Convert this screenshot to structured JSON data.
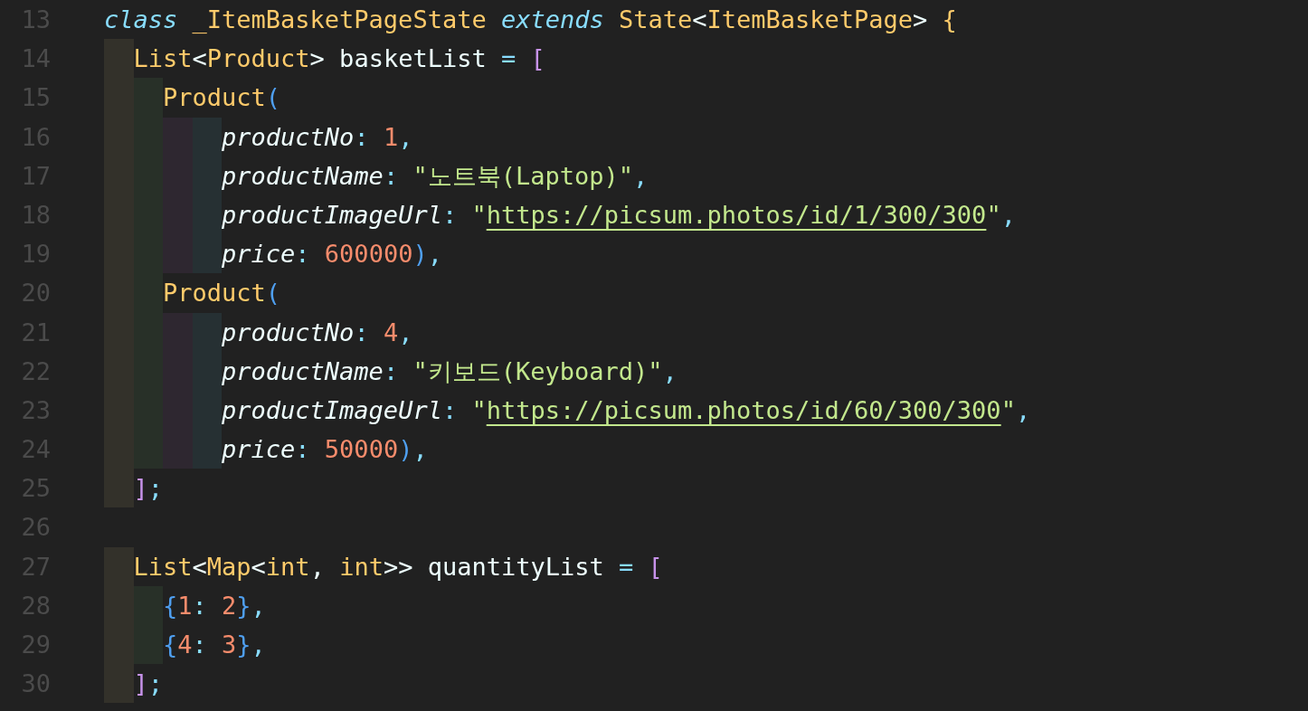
{
  "editor": {
    "lines": [
      {
        "number": "13",
        "tokens": [
          {
            "text": "class ",
            "kind": "keyword"
          },
          {
            "text": "_ItemBasketPageState ",
            "kind": "type"
          },
          {
            "text": "extends ",
            "kind": "keyword"
          },
          {
            "text": "State",
            "kind": "type"
          },
          {
            "text": "<",
            "kind": "plain"
          },
          {
            "text": "ItemBasketPage",
            "kind": "type"
          },
          {
            "text": "> ",
            "kind": "plain"
          },
          {
            "text": "{",
            "kind": "type"
          }
        ]
      },
      {
        "number": "14",
        "tokens": [
          {
            "text": "  List",
            "kind": "type"
          },
          {
            "text": "<",
            "kind": "plain"
          },
          {
            "text": "Product",
            "kind": "type"
          },
          {
            "text": "> basketList ",
            "kind": "plain"
          },
          {
            "text": "= ",
            "kind": "operator"
          },
          {
            "text": "[",
            "kind": "bracket-pink"
          }
        ]
      },
      {
        "number": "15",
        "tokens": [
          {
            "text": "    Product",
            "kind": "type"
          },
          {
            "text": "(",
            "kind": "bracket-blue"
          }
        ]
      },
      {
        "number": "16",
        "tokens": [
          {
            "text": "        productNo",
            "kind": "property"
          },
          {
            "text": ": ",
            "kind": "operator"
          },
          {
            "text": "1",
            "kind": "number"
          },
          {
            "text": ",",
            "kind": "operator"
          }
        ]
      },
      {
        "number": "17",
        "tokens": [
          {
            "text": "        productName",
            "kind": "property"
          },
          {
            "text": ": ",
            "kind": "operator"
          },
          {
            "text": "\"노트북(Laptop)\"",
            "kind": "string"
          },
          {
            "text": ",",
            "kind": "operator"
          }
        ]
      },
      {
        "number": "18",
        "tokens": [
          {
            "text": "        productImageUrl",
            "kind": "property"
          },
          {
            "text": ": ",
            "kind": "operator"
          },
          {
            "text": "\"",
            "kind": "string"
          },
          {
            "text": "https://picsum.photos/id/1/300/300",
            "kind": "link"
          },
          {
            "text": "\"",
            "kind": "string"
          },
          {
            "text": ",",
            "kind": "operator"
          }
        ]
      },
      {
        "number": "19",
        "tokens": [
          {
            "text": "        price",
            "kind": "property"
          },
          {
            "text": ": ",
            "kind": "operator"
          },
          {
            "text": "600000",
            "kind": "number"
          },
          {
            "text": ")",
            "kind": "bracket-blue"
          },
          {
            "text": ",",
            "kind": "operator"
          }
        ]
      },
      {
        "number": "20",
        "tokens": [
          {
            "text": "    Product",
            "kind": "type"
          },
          {
            "text": "(",
            "kind": "bracket-blue"
          }
        ]
      },
      {
        "number": "21",
        "tokens": [
          {
            "text": "        productNo",
            "kind": "property"
          },
          {
            "text": ": ",
            "kind": "operator"
          },
          {
            "text": "4",
            "kind": "number"
          },
          {
            "text": ",",
            "kind": "operator"
          }
        ]
      },
      {
        "number": "22",
        "tokens": [
          {
            "text": "        productName",
            "kind": "property"
          },
          {
            "text": ": ",
            "kind": "operator"
          },
          {
            "text": "\"키보드(Keyboard)\"",
            "kind": "string"
          },
          {
            "text": ",",
            "kind": "operator"
          }
        ]
      },
      {
        "number": "23",
        "tokens": [
          {
            "text": "        productImageUrl",
            "kind": "property"
          },
          {
            "text": ": ",
            "kind": "operator"
          },
          {
            "text": "\"",
            "kind": "string"
          },
          {
            "text": "https://picsum.photos/id/60/300/300",
            "kind": "link"
          },
          {
            "text": "\"",
            "kind": "string"
          },
          {
            "text": ",",
            "kind": "operator"
          }
        ]
      },
      {
        "number": "24",
        "tokens": [
          {
            "text": "        price",
            "kind": "property"
          },
          {
            "text": ": ",
            "kind": "operator"
          },
          {
            "text": "50000",
            "kind": "number"
          },
          {
            "text": ")",
            "kind": "bracket-blue"
          },
          {
            "text": ",",
            "kind": "operator"
          }
        ]
      },
      {
        "number": "25",
        "tokens": [
          {
            "text": "  ]",
            "kind": "bracket-pink"
          },
          {
            "text": ";",
            "kind": "operator"
          }
        ]
      },
      {
        "number": "26"
      },
      {
        "number": "27",
        "tokens": [
          {
            "text": "  List",
            "kind": "type"
          },
          {
            "text": "<",
            "kind": "plain"
          },
          {
            "text": "Map",
            "kind": "type"
          },
          {
            "text": "<",
            "kind": "plain"
          },
          {
            "text": "int",
            "kind": "type"
          },
          {
            "text": ", ",
            "kind": "plain"
          },
          {
            "text": "int",
            "kind": "type"
          },
          {
            "text": ">> quantityList ",
            "kind": "plain"
          },
          {
            "text": "= ",
            "kind": "operator"
          },
          {
            "text": "[",
            "kind": "bracket-pink"
          }
        ]
      },
      {
        "number": "28",
        "tokens": [
          {
            "text": "    {",
            "kind": "bracket-blue"
          },
          {
            "text": "1",
            "kind": "number"
          },
          {
            "text": ": ",
            "kind": "operator"
          },
          {
            "text": "2",
            "kind": "number"
          },
          {
            "text": "}",
            "kind": "bracket-blue"
          },
          {
            "text": ",",
            "kind": "operator"
          }
        ]
      },
      {
        "number": "29",
        "tokens": [
          {
            "text": "    {",
            "kind": "bracket-blue"
          },
          {
            "text": "4",
            "kind": "number"
          },
          {
            "text": ": ",
            "kind": "operator"
          },
          {
            "text": "3",
            "kind": "number"
          },
          {
            "text": "}",
            "kind": "bracket-blue"
          },
          {
            "text": ",",
            "kind": "operator"
          }
        ]
      },
      {
        "number": "30",
        "tokens": [
          {
            "text": "  ]",
            "kind": "bracket-pink"
          },
          {
            "text": ";",
            "kind": "operator"
          }
        ]
      }
    ]
  }
}
